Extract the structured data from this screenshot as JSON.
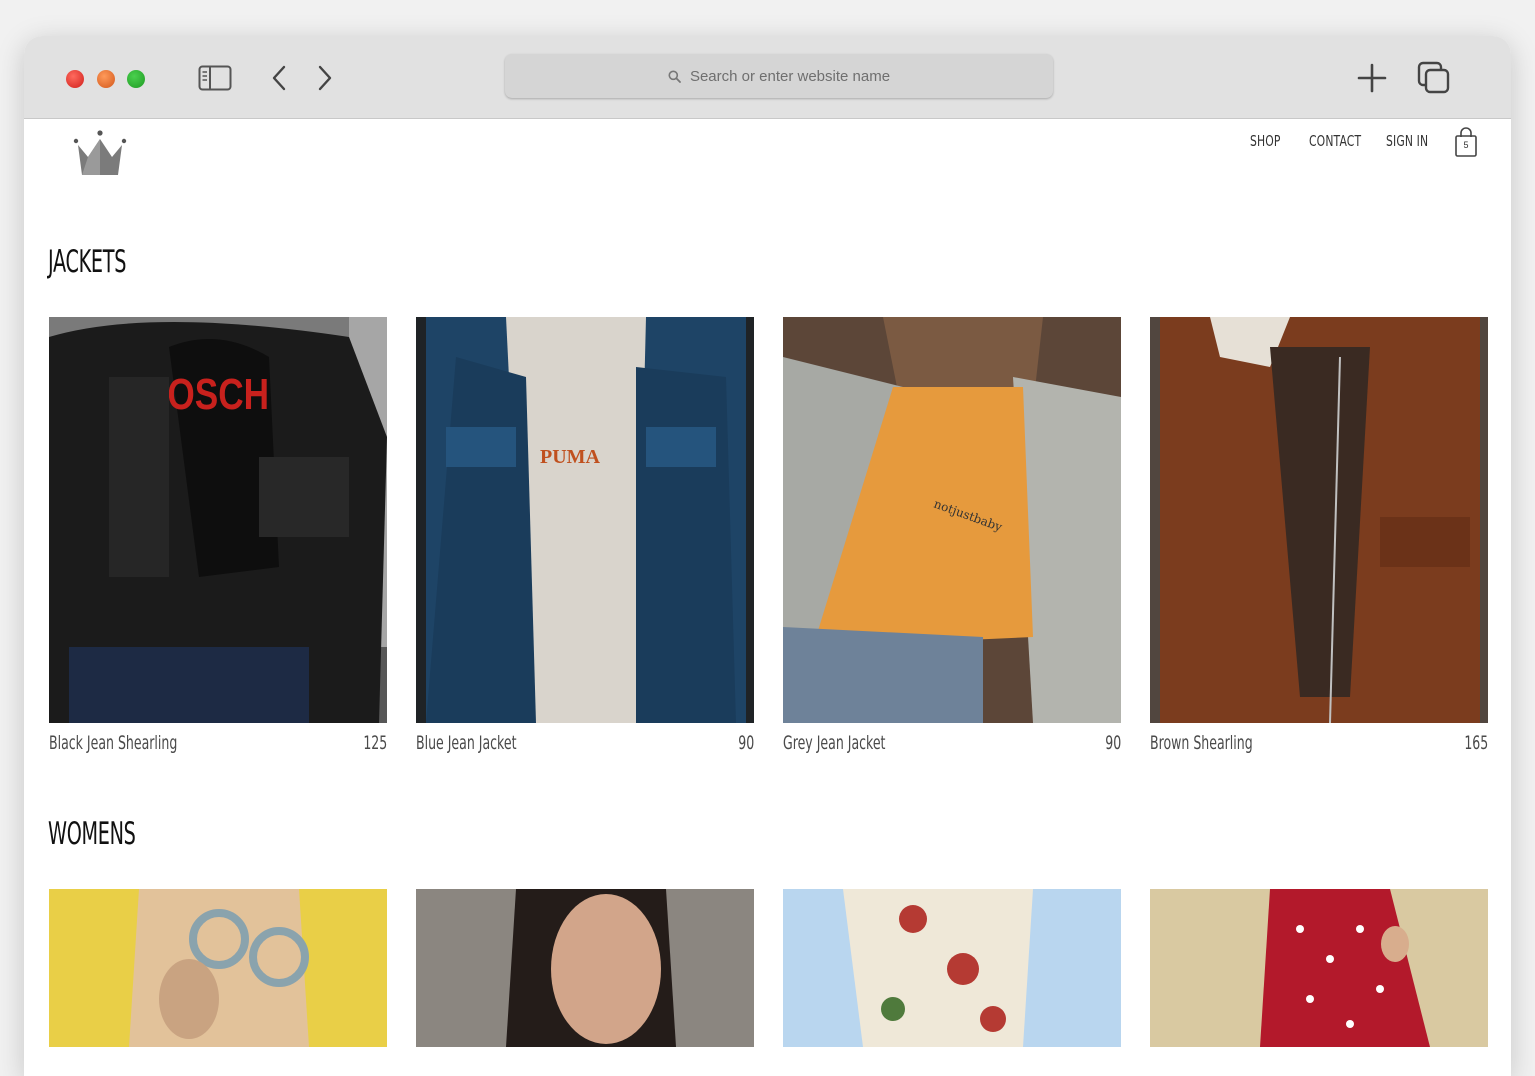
{
  "browser": {
    "address_placeholder": "Search or enter website name",
    "icons": {
      "sidebar": "sidebar-icon",
      "back": "chevron-left-icon",
      "forward": "chevron-right-icon",
      "new_tab": "plus-icon",
      "tabs": "tabs-overview-icon",
      "search": "search-icon"
    }
  },
  "header": {
    "logo": "crown-logo",
    "nav": [
      {
        "label": "SHOP"
      },
      {
        "label": "CONTACT"
      },
      {
        "label": "SIGN IN"
      }
    ],
    "cart_count": "5",
    "cart_icon": "shopping-bag-icon"
  },
  "sections": [
    {
      "title": "JACKETS",
      "items": [
        {
          "name": "Black Jean Shearling",
          "price": "125"
        },
        {
          "name": "Blue Jean Jacket",
          "price": "90"
        },
        {
          "name": "Grey Jean Jacket",
          "price": "90"
        },
        {
          "name": "Brown Shearling",
          "price": "165"
        }
      ]
    },
    {
      "title": "WOMENS",
      "items": [
        {
          "name": "",
          "price": ""
        },
        {
          "name": "",
          "price": ""
        },
        {
          "name": "",
          "price": ""
        },
        {
          "name": "",
          "price": ""
        }
      ]
    }
  ],
  "colors": {
    "window_chrome": "#e1e1e1",
    "page_background": "#ffffff",
    "text_primary": "#111111",
    "text_secondary": "#4a4a4a"
  }
}
